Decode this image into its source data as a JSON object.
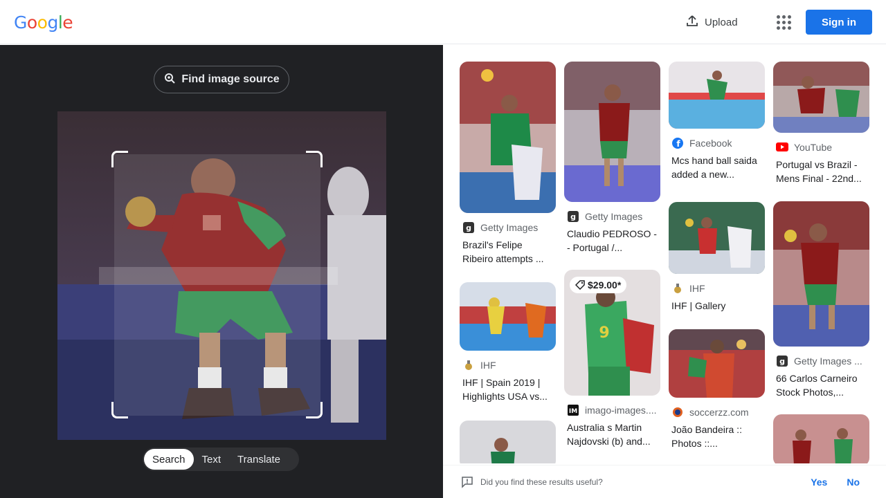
{
  "header": {
    "logo_letters": [
      {
        "ch": "G",
        "color": "#4285F4"
      },
      {
        "ch": "o",
        "color": "#EA4335"
      },
      {
        "ch": "o",
        "color": "#FBBC05"
      },
      {
        "ch": "g",
        "color": "#4285F4"
      },
      {
        "ch": "l",
        "color": "#34A853"
      },
      {
        "ch": "e",
        "color": "#EA4335"
      }
    ],
    "upload_label": "Upload",
    "apps_icon": "apps-grid-icon",
    "signin_label": "Sign in"
  },
  "lens": {
    "find_source_label": "Find image source",
    "modes": [
      "Search",
      "Text",
      "Translate"
    ],
    "active_mode": "Search"
  },
  "results": [
    {
      "source": "Getty Images",
      "source_icon": "getty-icon",
      "title": "Brazil's Felipe Ribeiro attempts ..."
    },
    {
      "source": "IHF",
      "source_icon": "ihf-icon",
      "title": "IHF | Spain 2019 | Highlights USA vs..."
    },
    {
      "source": "",
      "source_icon": "",
      "title": ""
    },
    {
      "source": "Getty Images",
      "source_icon": "getty-icon",
      "title": "Claudio PEDROSO - - Portugal /..."
    },
    {
      "source": "imago-images....",
      "source_icon": "imago-icon",
      "title": "Australia s Martin Najdovski (b) and...",
      "price": "$29.00*"
    },
    {
      "source": "Facebook",
      "source_icon": "facebook-icon",
      "title": "Mcs hand ball saida added a new..."
    },
    {
      "source": "IHF",
      "source_icon": "ihf-icon",
      "title": "IHF | Gallery"
    },
    {
      "source": "soccerzz.com",
      "source_icon": "soccerzz-icon",
      "title": "João Bandeira :: Photos ::..."
    },
    {
      "source": "YouTube",
      "source_icon": "youtube-icon",
      "title": "Portugal vs Brazil - Mens Final - 22nd..."
    },
    {
      "source": "Getty Images ...",
      "source_icon": "getty-icon",
      "title": "66 Carlos Carneiro Stock Photos,..."
    }
  ],
  "feedback": {
    "question": "Did you find these results useful?",
    "yes_label": "Yes",
    "no_label": "No"
  },
  "colors": {
    "brand_blue": "#1a73e8",
    "panel_dark": "#202124",
    "jersey_red": "#8b1a1a",
    "jersey_green": "#2f8f4e"
  }
}
